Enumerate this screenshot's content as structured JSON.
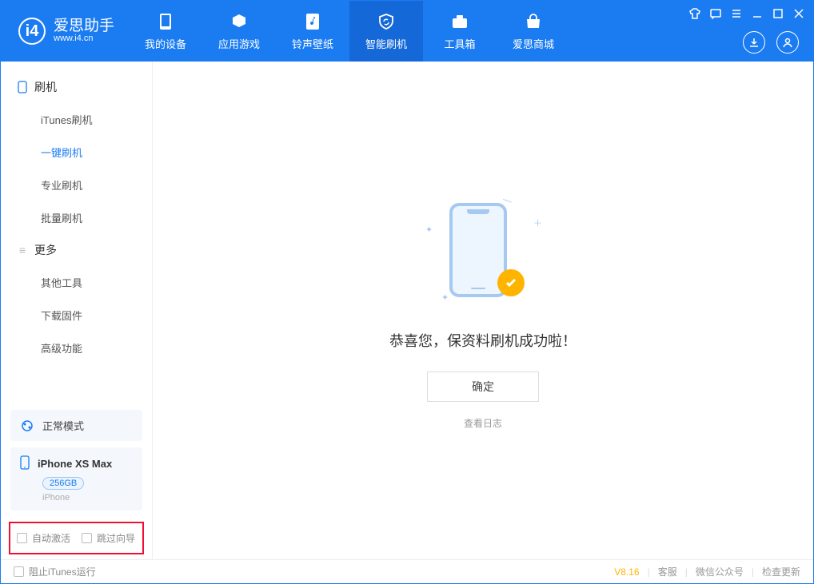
{
  "app": {
    "name_cn": "爱思助手",
    "name_en": "www.i4.cn"
  },
  "header_tabs": [
    {
      "label": "我的设备"
    },
    {
      "label": "应用游戏"
    },
    {
      "label": "铃声壁纸"
    },
    {
      "label": "智能刷机"
    },
    {
      "label": "工具箱"
    },
    {
      "label": "爱思商城"
    }
  ],
  "sidebar": {
    "group1_label": "刷机",
    "group1_items": [
      "iTunes刷机",
      "一键刷机",
      "专业刷机",
      "批量刷机"
    ],
    "group2_label": "更多",
    "group2_items": [
      "其他工具",
      "下载固件",
      "高级功能"
    ]
  },
  "mode_card": {
    "label": "正常模式"
  },
  "device": {
    "name": "iPhone XS Max",
    "storage": "256GB",
    "type": "iPhone"
  },
  "options": {
    "auto_activate": "自动激活",
    "skip_guide": "跳过向导"
  },
  "main": {
    "success_title": "恭喜您，保资料刷机成功啦！",
    "ok": "确定",
    "view_log": "查看日志"
  },
  "footer": {
    "block_itunes": "阻止iTunes运行",
    "version": "V8.16",
    "links": [
      "客服",
      "微信公众号",
      "检查更新"
    ]
  }
}
